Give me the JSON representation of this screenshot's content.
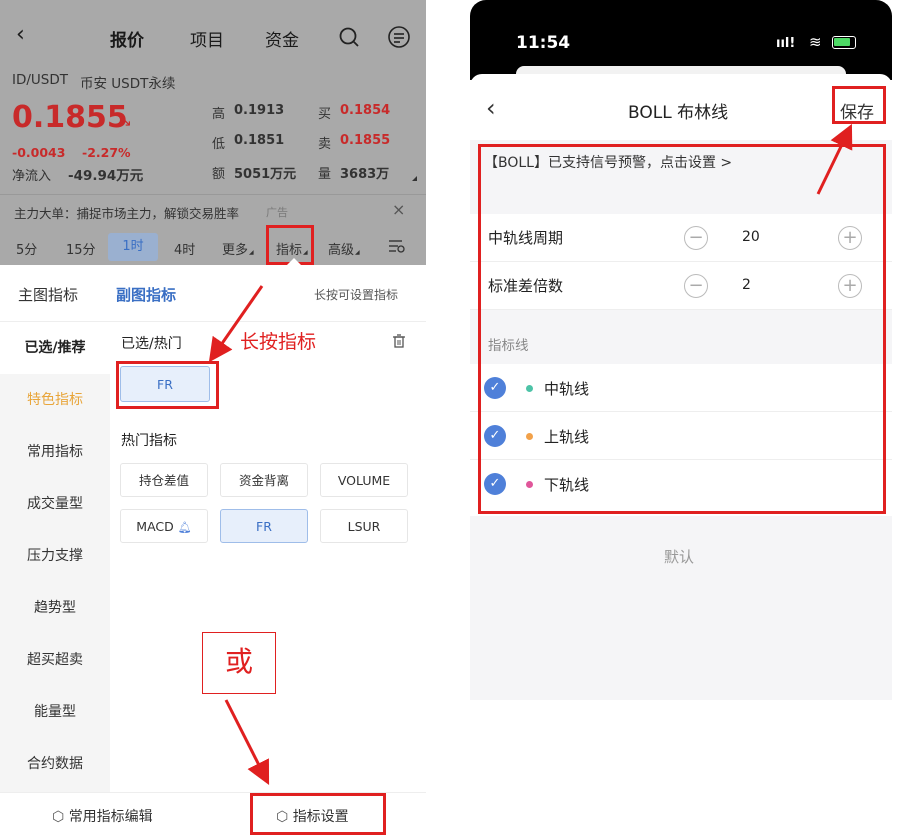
{
  "left": {
    "nav": {
      "title": "报价",
      "tab_project": "项目",
      "tab_funds": "资金"
    },
    "pair": {
      "symbol": "ID/USDT",
      "market": "币安 USDT永续"
    },
    "price": {
      "last": "0.1855",
      "change": "-0.0043",
      "change_pct": "-2.27%",
      "inflow_label": "净流入",
      "inflow_value": "-49.94万元"
    },
    "stats": {
      "high_label": "高",
      "high": "0.1913",
      "low_label": "低",
      "low": "0.1851",
      "amount_label": "额",
      "amount": "5051万元",
      "buy_label": "买",
      "buy": "0.1854",
      "sell_label": "卖",
      "sell": "0.1855",
      "volume_label": "量",
      "volume": "3683万"
    },
    "ad": {
      "text": "主力大单：捕捉市场主力，解锁交易胜率",
      "tag": "广告"
    },
    "timeframes": [
      "5分",
      "15分",
      "1时",
      "4时",
      "更多",
      "指标",
      "高级"
    ],
    "sheet": {
      "tab_main": "主图指标",
      "tab_sub": "副图指标",
      "hint": "长按可设置指标",
      "sidebar": [
        "已选/推荐",
        "特色指标",
        "常用指标",
        "成交量型",
        "压力支撑",
        "趋势型",
        "超买超卖",
        "能量型",
        "合约数据"
      ],
      "selected_title": "已选/热门",
      "selected_chip": "FR",
      "hot_title": "热门指标",
      "hot": [
        "持仓差值",
        "资金背离",
        "VOLUME",
        "MACD",
        "FR",
        "LSUR"
      ],
      "btn_edit": "常用指标编辑",
      "btn_settings": "指标设置"
    },
    "annotations": {
      "long_press": "长按指标",
      "or": "或"
    }
  },
  "right": {
    "status": {
      "time": "11:54"
    },
    "header": {
      "title": "BOLL 布林线",
      "save": "保存"
    },
    "notice": "【BOLL】已支持信号预警，点击设置 >",
    "params": [
      {
        "label": "中轨线周期",
        "value": "20"
      },
      {
        "label": "标准差倍数",
        "value": "2"
      }
    ],
    "lines_title": "指标线",
    "lines": [
      {
        "label": "中轨线",
        "color": "#4dc3a7"
      },
      {
        "label": "上轨线",
        "color": "#f2a14a"
      },
      {
        "label": "下轨线",
        "color": "#e0569a"
      }
    ],
    "default": "默认"
  },
  "colors": {
    "annotation_red": "#e02020",
    "accent_blue": "#3a6fc4",
    "price_red": "#c82a2a"
  }
}
